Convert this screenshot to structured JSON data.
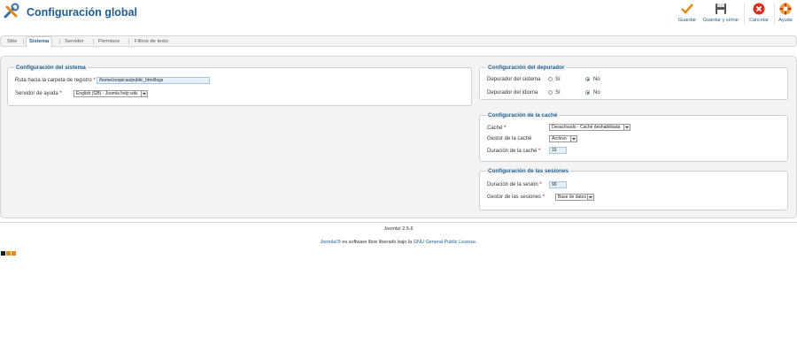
{
  "header": {
    "title": "Configuración global",
    "toolbar": {
      "save": "Guardar",
      "save_close": "Guardar y cerrar",
      "cancel": "Cancelar",
      "help": "Ayuda"
    }
  },
  "tabs": [
    "Sitio",
    "Sistema",
    "Servidor",
    "Permisos",
    "Filtros de texto"
  ],
  "active_tab": "Sistema",
  "system": {
    "legend": "Configuración del sistema",
    "log_path_label": "Ruta hacia la carpeta de registro",
    "log_path_value": "/home/zoopicas/public_html/logs",
    "help_server_label": "Servidor de ayuda",
    "help_server_value": "English (GB) - Joomla help wiki"
  },
  "debug": {
    "legend": "Configuración del depurador",
    "system_label": "Depurador del sistema",
    "language_label": "Depurador del idioma",
    "yes": "Sí",
    "no": "No"
  },
  "cache": {
    "legend": "Configuración de la caché",
    "cache_label": "Caché",
    "cache_value": "Desactivado - Caché deshabilitada",
    "handler_label": "Gestor de la caché",
    "handler_value": "Archivo",
    "time_label": "Duración de la caché",
    "time_value": "15"
  },
  "session": {
    "legend": "Configuración de las sesiones",
    "lifetime_label": "Duración de la sesión",
    "lifetime_value": "90",
    "handler_label": "Gestor de las sesiones",
    "handler_value": "Base de datos"
  },
  "footer": {
    "version": "Joomla! 2.5.6",
    "license_link1": "Joomla!®",
    "license_text": " es software libre liberado bajo la ",
    "license_link2": "GNU General Public License",
    "license_end": "."
  },
  "colors": {
    "accent": "#1e5d8e",
    "required": "#cc0000"
  }
}
